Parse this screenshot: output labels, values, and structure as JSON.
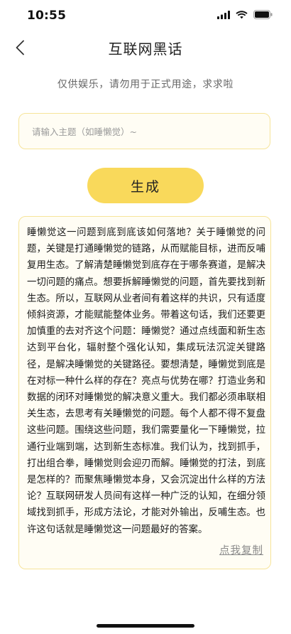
{
  "status_bar": {
    "time": "10:55",
    "icons": [
      "cellular-signal-icon",
      "wifi-icon",
      "battery-icon"
    ]
  },
  "nav": {
    "back_icon": "chevron-left-icon",
    "title": "互联网黑话"
  },
  "disclaimer": "仅供娱乐，请勿用于正式用途，求求啦",
  "topic_input": {
    "value": "",
    "placeholder": "请输入主题（如睡懒觉）~"
  },
  "generate_button": {
    "label": "生成"
  },
  "result": {
    "text": "睡懒觉这一问题到底到底该如何落地？关于睡懒觉的问题，关键是打通睡懒觉的链路，从而赋能目标，进而反哺复用生态。了解清楚睡懒觉到底存在于哪条赛道，是解决一切问题的痛点。想要拆解睡懒觉的问题，首先要找到新生态。所以，互联网从业者间有着这样的共识，只有适度倾斜资源，才能赋能整体业务。带着这句话，我们还要更加慎重的去对齐这个问题：睡懒觉？通过点线面和新生态达到平台化，辐射整个强化认知，集成玩法沉淀关键路径，是解决睡懒觉的关键路径。要想清楚，睡懒觉到底是在对标一种什么样的存在？亮点与优势在哪？打造业务和数据的闭环对睡懒觉的解决意义重大。我们都必须串联相关生态，去思考有关睡懒觉的问题。每个人都不得不复盘这些问题。围绕这些问题，我们需要量化一下睡懒觉，拉通行业端到端，达到新生态标准。我们认为，找到抓手，打出组合拳，睡懒觉则会迎刃而解。睡懒觉的打法，到底是怎样的？而聚焦睡懒觉本身，又会沉淀出什么样的方法论？互联网研发人员间有这样一种广泛的认知，在细分领域找到抓手，形成方法论，才能对外输出，反哺生态。也许这句话就是睡懒觉这一问题最好的答案。",
    "copy_label": "点我复制"
  },
  "colors": {
    "accent_yellow": "#f9d95b",
    "box_border": "#f6e49a",
    "box_background": "#fffdf4"
  }
}
